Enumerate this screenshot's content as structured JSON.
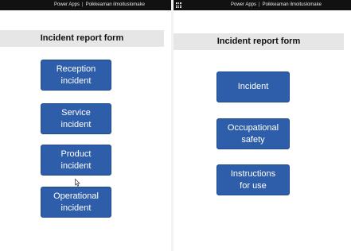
{
  "left": {
    "topbar": {
      "app_name": "Power Apps",
      "separator": "|",
      "app_title": "Poikkeaman ilmoituslomake"
    },
    "form_title": "Incident report form",
    "buttons": [
      {
        "line1": "Reception",
        "line2": "incident"
      },
      {
        "line1": "Service",
        "line2": "incident"
      },
      {
        "line1": "Product",
        "line2": "incident"
      },
      {
        "line1": "Operational",
        "line2": "incident"
      }
    ]
  },
  "right": {
    "topbar": {
      "app_name": "Power Apps",
      "separator": "|",
      "app_title": "Poikkeaman ilmoituslomake"
    },
    "form_title": "Incident report form",
    "buttons": [
      {
        "line1": "Incident",
        "line2": ""
      },
      {
        "line1": "Occupational",
        "line2": "safety"
      },
      {
        "line1": "Instructions",
        "line2": "for use"
      }
    ]
  },
  "colors": {
    "button_fill": "#2e5eaa",
    "button_text": "#ffffff",
    "header_band": "#e6e6e6",
    "topbar": "#111111"
  },
  "icons": {
    "app_launcher": "waffle-icon",
    "pointer": "mouse-cursor-icon"
  }
}
